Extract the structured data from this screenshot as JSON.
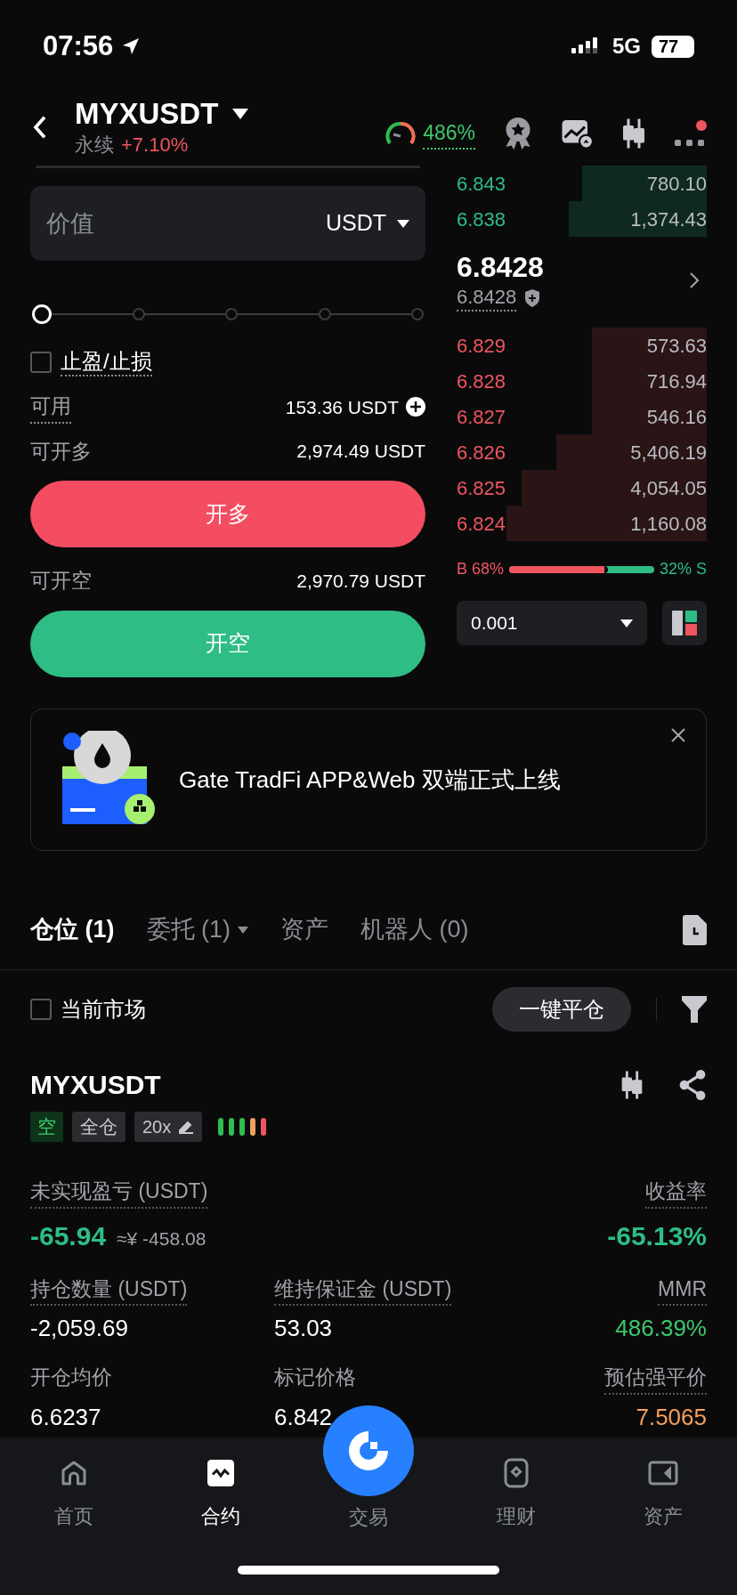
{
  "status_bar": {
    "time": "07:56",
    "network": "5G",
    "battery": "77"
  },
  "header": {
    "symbol": "MYXUSDT",
    "contract_type": "永续",
    "change": "+7.10%",
    "risk_reading": "486%",
    "has_notification": true
  },
  "order_form": {
    "value_label": "价值",
    "unit": "USDT",
    "slider": {
      "level": 0
    },
    "tpsl": {
      "label": "止盈/止损",
      "checked": false
    },
    "available_label": "可用",
    "available": "153.36 USDT",
    "max_long_label": "可开多",
    "max_long": "2,974.49 USDT",
    "long_button": "开多",
    "max_short_label": "可开空",
    "max_short": "2,970.79 USDT",
    "short_button": "开空"
  },
  "order_book": {
    "upper_rows": [
      {
        "price": "6.843",
        "amount": "780.10"
      },
      {
        "price": "6.838",
        "amount": "1,374.43"
      }
    ],
    "last_price": "6.8428",
    "mark_price": "6.8428",
    "lower_rows": [
      {
        "price": "6.829",
        "amount": "573.63"
      },
      {
        "price": "6.828",
        "amount": "716.94"
      },
      {
        "price": "6.827",
        "amount": "546.16"
      },
      {
        "price": "6.826",
        "amount": "5,406.19"
      },
      {
        "price": "6.825",
        "amount": "4,054.05"
      },
      {
        "price": "6.824",
        "amount": "1,160.08"
      }
    ],
    "ratio": {
      "buy_label": "B 68%",
      "sell_label": "32% S",
      "level": 0.68
    },
    "precision": "0.001"
  },
  "banner": {
    "text": "Gate TradFi APP&Web 双端正式上线"
  },
  "tabs": [
    {
      "label": "仓位 (1)",
      "selected": true,
      "dropdown": false
    },
    {
      "label": "委托 (1)",
      "selected": false,
      "dropdown": true
    },
    {
      "label": "资产",
      "selected": false,
      "dropdown": false
    },
    {
      "label": "机器人 (0)",
      "selected": false,
      "dropdown": false
    }
  ],
  "filter": {
    "label": "当前市场",
    "checked": false,
    "close_all": "一键平仓"
  },
  "position": {
    "symbol": "MYXUSDT",
    "tags": [
      {
        "label": "空",
        "kind": "side"
      },
      {
        "label": "全仓",
        "kind": "plain"
      },
      {
        "label": "20x",
        "kind": "leverage"
      }
    ],
    "risk_bars": [
      {
        "color": "#2ebd4e"
      },
      {
        "color": "#2ebd4e"
      },
      {
        "color": "#2ebd4e"
      },
      {
        "color": "#f0a060"
      },
      {
        "color": "#f0555f"
      }
    ],
    "pnl_label": "未实现盈亏 (USDT)",
    "pnl": "-65.94",
    "pnl_cny": "≈¥ -458.08",
    "roe_label": "收益率",
    "roe": "-65.13%",
    "fields": [
      {
        "label": "持仓数量 (USDT)",
        "value": "-2,059.69",
        "color": "#ffffff",
        "dotted": true
      },
      {
        "label": "维持保证金 (USDT)",
        "value": "53.03",
        "color": "#ffffff",
        "dotted": true
      },
      {
        "label": "MMR",
        "value": "486.39%",
        "color": "#3cc86a",
        "dotted": true
      },
      {
        "label": "开仓均价",
        "value": "6.6237",
        "color": "#ffffff",
        "dotted": false
      },
      {
        "label": "标记价格",
        "value": "6.842",
        "color": "#ffffff",
        "dotted": false
      },
      {
        "label": "预估强平价",
        "value": "7.5065",
        "color": "#f5a05a",
        "dotted": true
      }
    ]
  },
  "nav": [
    {
      "label": "首页",
      "kind": "home",
      "selected": false
    },
    {
      "label": "合约",
      "kind": "futures",
      "selected": true
    },
    {
      "label": "交易",
      "kind": "center",
      "selected": false
    },
    {
      "label": "理财",
      "kind": "earn",
      "selected": false
    },
    {
      "label": "资产",
      "kind": "assets",
      "selected": false
    }
  ]
}
